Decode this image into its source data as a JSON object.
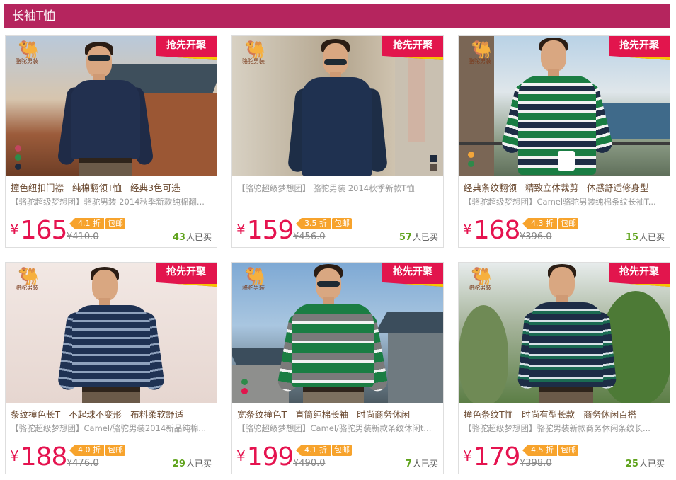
{
  "section": {
    "title": "长袖T恤"
  },
  "colors": {
    "header": "#b5255e",
    "price": "#e5134f",
    "tag": "#f7a32c",
    "sold_count": "#5fa31c",
    "promo": "#e2154d"
  },
  "products": [
    {
      "brand": "骆驼男装",
      "promo": "抢先开聚",
      "features": [
        "撞色纽扣门襟",
        "纯棉翻领T恤",
        "经典3色可选"
      ],
      "subtitle": "【骆驼超级梦想团】骆驼男装 2014秋季新款纯棉翻...",
      "currency": "¥",
      "price": "165",
      "discount": "4.1 折",
      "shipping": "包邮",
      "original_price": "¥410.0",
      "sold_count": "43",
      "sold_label": "人已买"
    },
    {
      "brand": "骆驼男装",
      "promo": "抢先开聚",
      "features": [],
      "subtitle": "【骆驼超级梦想团】 骆驼男装 2014秋季新款T恤",
      "currency": "¥",
      "price": "159",
      "discount": "3.5 折",
      "shipping": "包邮",
      "original_price": "¥456.0",
      "sold_count": "57",
      "sold_label": "人已买"
    },
    {
      "brand": "骆驼男装",
      "promo": "抢先开聚",
      "features": [
        "经典条纹翻领",
        "精致立体裁剪",
        "体感舒适修身型"
      ],
      "subtitle": "【骆驼超级梦想团】Camel骆驼男装纯棉条纹长袖T...",
      "currency": "¥",
      "price": "168",
      "discount": "4.3 折",
      "shipping": "包邮",
      "original_price": "¥396.0",
      "sold_count": "15",
      "sold_label": "人已买"
    },
    {
      "brand": "骆驼男装",
      "promo": "抢先开聚",
      "features": [
        "条纹撞色长T",
        "不起球不变形",
        "布料柔软舒适"
      ],
      "subtitle": "【骆驼超级梦想团】Camel/骆驼男装2014新品纯棉...",
      "currency": "¥",
      "price": "188",
      "discount": "4.0 折",
      "shipping": "包邮",
      "original_price": "¥476.0",
      "sold_count": "29",
      "sold_label": "人已买"
    },
    {
      "brand": "骆驼男装",
      "promo": "抢先开聚",
      "features": [
        "宽条纹撞色T",
        "直筒纯棉长袖",
        "时尚商务休闲"
      ],
      "subtitle": "【骆驼超级梦想团】Camel/骆驼男装新款条纹休闲t...",
      "currency": "¥",
      "price": "199",
      "discount": "4.1 折",
      "shipping": "包邮",
      "original_price": "¥490.0",
      "sold_count": "7",
      "sold_label": "人已买"
    },
    {
      "brand": "骆驼男装",
      "promo": "抢先开聚",
      "features": [
        "撞色条纹T恤",
        "时尚有型长款",
        "商务休闲百搭"
      ],
      "subtitle": "【骆驼超级梦想团】骆驼男装新款商务休闲条纹长...",
      "currency": "¥",
      "price": "179",
      "discount": "4.5 折",
      "shipping": "包邮",
      "original_price": "¥398.0",
      "sold_count": "25",
      "sold_label": "人已买"
    }
  ]
}
